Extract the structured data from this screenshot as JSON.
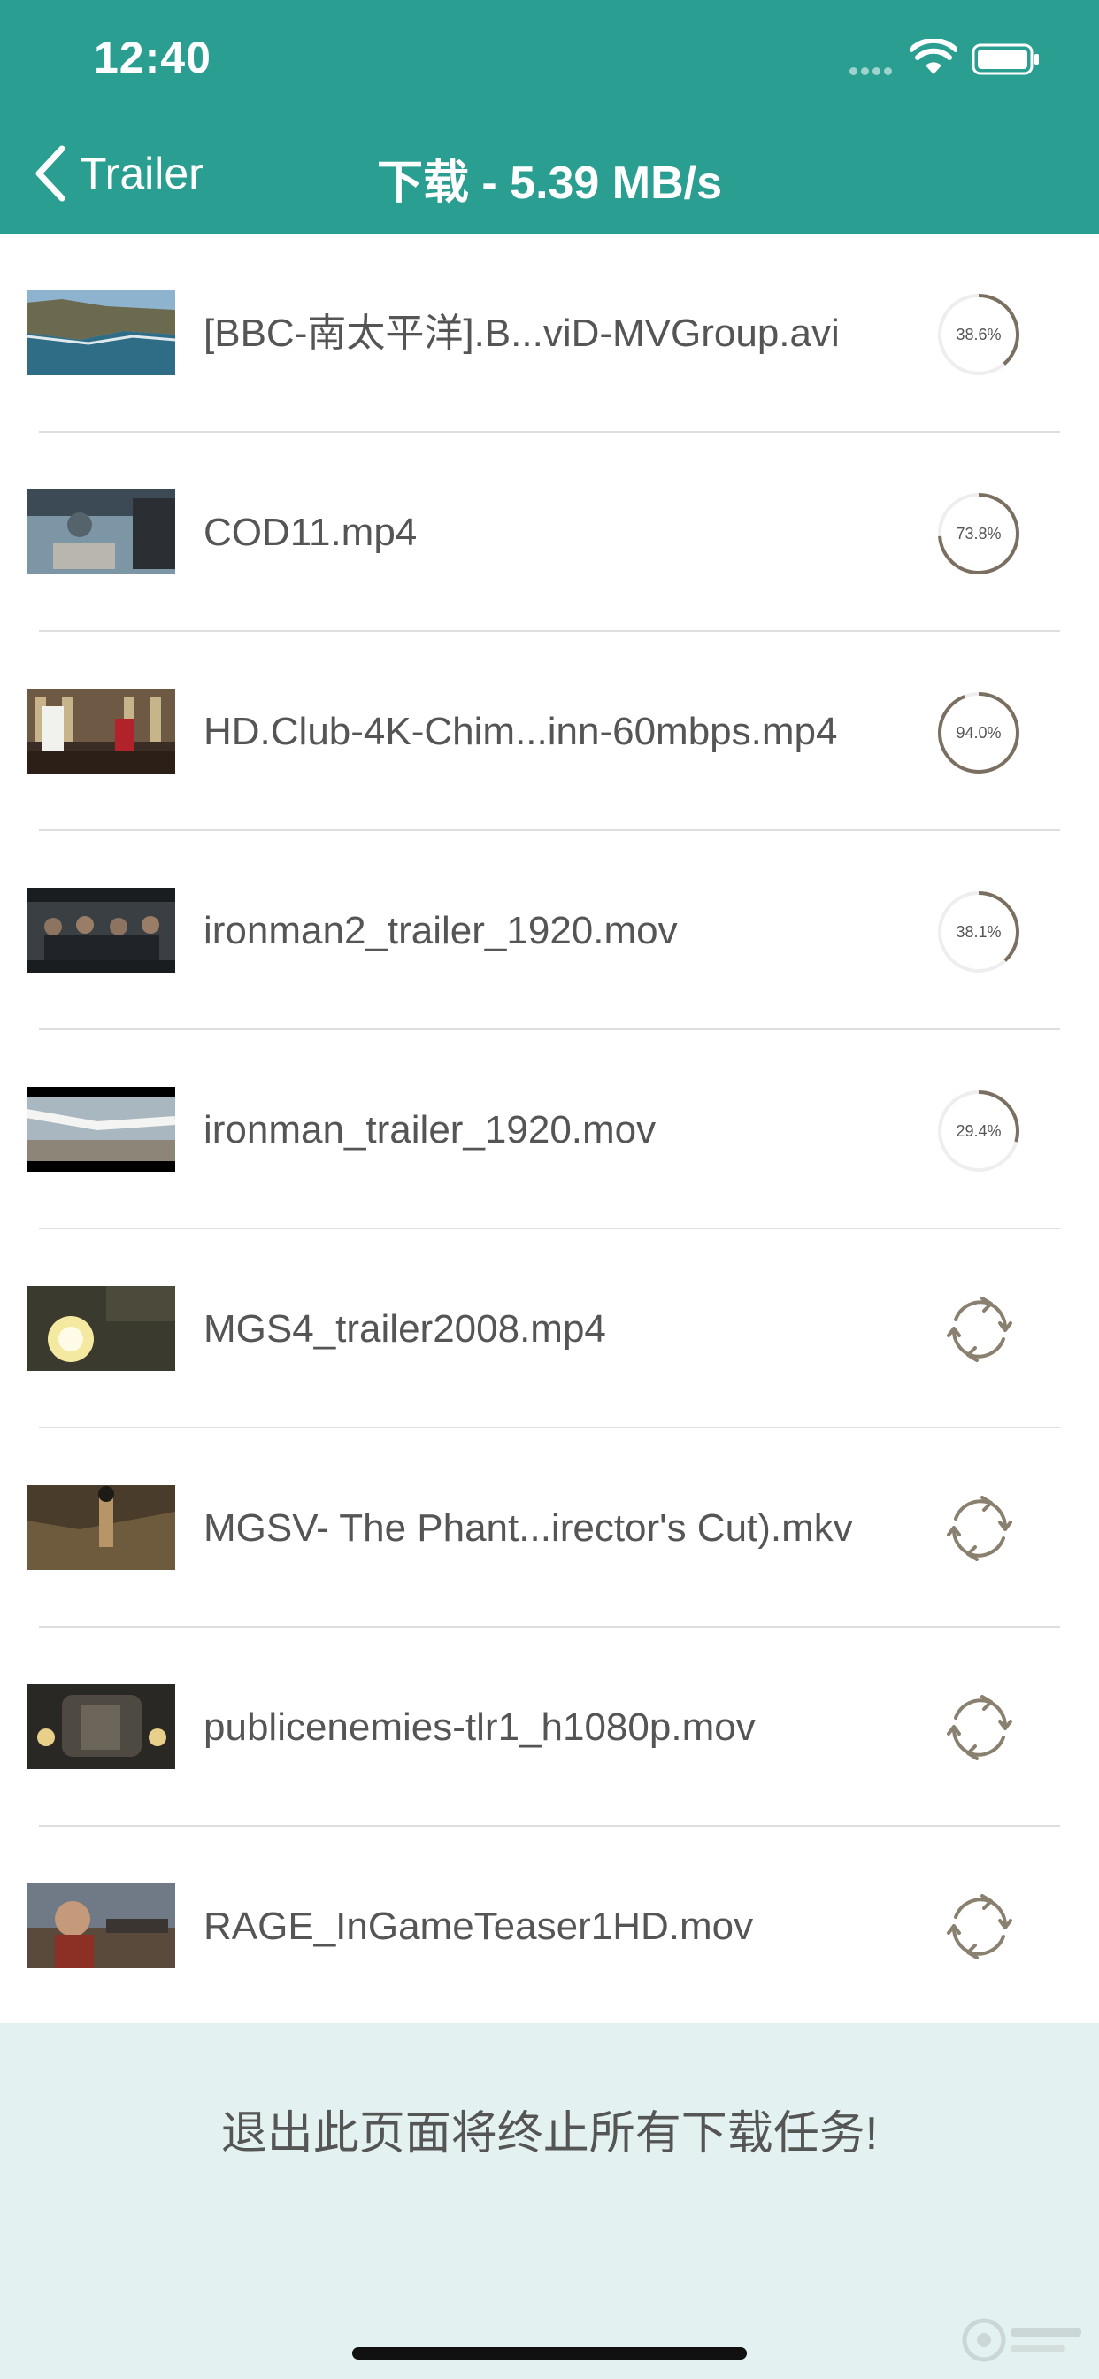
{
  "status_bar": {
    "time": "12:40"
  },
  "nav": {
    "back_label": "Trailer",
    "title": "下载 - 5.39 MB/s"
  },
  "colors": {
    "header": "#2b9e92",
    "footer": "#e3f2f0",
    "progress_arc": "#7a6f60",
    "progress_track": "#eeeeee"
  },
  "downloads": [
    {
      "name": "[BBC-南太平洋].B...viD-MVGroup.avi",
      "state": "downloading",
      "progress": 0.386,
      "progress_label": "38.6%",
      "thumb": "coastline"
    },
    {
      "name": "COD11.mp4",
      "state": "downloading",
      "progress": 0.738,
      "progress_label": "73.8%",
      "thumb": "mech"
    },
    {
      "name": "HD.Club-4K-Chim...inn-60mbps.mp4",
      "state": "downloading",
      "progress": 0.94,
      "progress_label": "94.0%",
      "thumb": "chefs"
    },
    {
      "name": "ironman2_trailer_1920.mov",
      "state": "downloading",
      "progress": 0.381,
      "progress_label": "38.1%",
      "thumb": "hearing"
    },
    {
      "name": "ironman_trailer_1920.mov",
      "state": "downloading",
      "progress": 0.294,
      "progress_label": "29.4%",
      "thumb": "desert"
    },
    {
      "name": "MGS4_trailer2008.mp4",
      "state": "waiting",
      "icon": "refresh-icon",
      "thumb": "explosion"
    },
    {
      "name": "MGSV- The Phant...irector's Cut).mkv",
      "state": "waiting",
      "icon": "refresh-icon",
      "thumb": "soldier"
    },
    {
      "name": "publicenemies-tlr1_h1080p.mov",
      "state": "waiting",
      "icon": "refresh-icon",
      "thumb": "car"
    },
    {
      "name": "RAGE_InGameTeaser1HD.mov",
      "state": "waiting",
      "icon": "refresh-icon",
      "thumb": "warrior"
    }
  ],
  "footer": {
    "note": "退出此页面将终止所有下载任务!"
  }
}
